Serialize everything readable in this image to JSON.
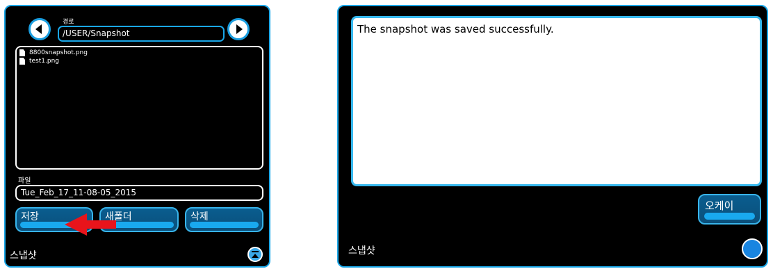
{
  "left_panel": {
    "path_label": "경로",
    "path_value": "/USER/Snapshot",
    "files": [
      {
        "name": "8800snapshot.png"
      },
      {
        "name": "test1.png"
      }
    ],
    "file_label": "파일",
    "filename_value": "Tue_Feb_17_11-08-05_2015",
    "buttons": {
      "save": "저장",
      "new_folder": "새폴더",
      "delete": "삭제"
    },
    "title": "스냅샷"
  },
  "right_panel": {
    "message": "The snapshot was saved successfully.",
    "ok_label": "오케이",
    "title": "스냅샷"
  },
  "icons": {
    "back": "arrow-left-icon",
    "forward": "arrow-right-icon",
    "file": "file-icon",
    "collapse": "collapse-icon",
    "annotation": "red-arrow-annotation"
  },
  "colors": {
    "accent": "#1aa7e8",
    "button_bar": "#19a9ef",
    "annotation": "#e8141b"
  }
}
